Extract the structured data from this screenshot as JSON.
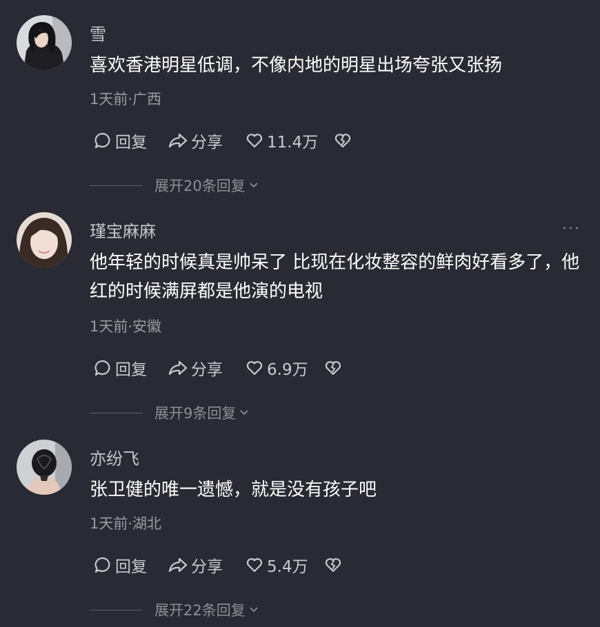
{
  "comments": [
    {
      "username": "雪",
      "text": "喜欢香港明星低调，不像内地的明星出场夸张又张扬",
      "meta": "1天前·广西",
      "reply_label": "回复",
      "share_label": "分享",
      "likes": "11.4万",
      "expand_label": "展开20条回复",
      "avatar_icon": "woman-dark-hair-photo"
    },
    {
      "username": "瑾宝麻麻",
      "more": "···",
      "text": "他年轻的时候真是帅呆了 比现在化妆整容的鲜肉好看多了，他红的时候满屏都是他演的电视",
      "meta": "1天前·安徽",
      "reply_label": "回复",
      "share_label": "分享",
      "likes": "6.9万",
      "expand_label": "展开9条回复",
      "avatar_icon": "smiling-girl-photo"
    },
    {
      "username": "亦纷飞",
      "text": "张卫健的唯一遗憾，就是没有孩子吧",
      "meta": "1天前·湖北",
      "reply_label": "回复",
      "share_label": "分享",
      "likes": "5.4万",
      "expand_label": "展开22条回复",
      "avatar_icon": "hair-bun-back-photo"
    }
  ],
  "colors": {
    "background": "#292a33",
    "username": "#c6c7cd",
    "text": "#ffffff",
    "meta": "#9a9ba2",
    "action": "#c9cad0",
    "expand": "#8e8f96"
  }
}
